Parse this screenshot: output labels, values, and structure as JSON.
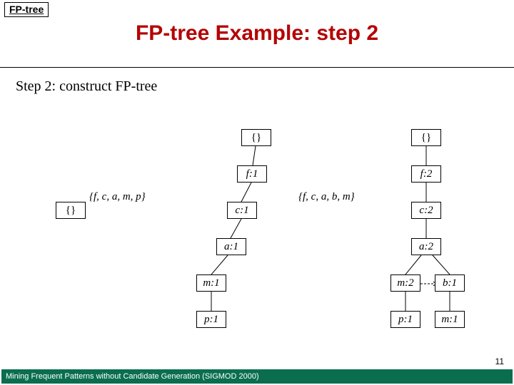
{
  "topic": "FP-tree",
  "title": "FP-tree Example: step 2",
  "step_label": "Step 2: construct  FP-tree",
  "footer": "Mining Frequent Patterns without Candidate Generation (SIGMOD 2000)",
  "page_number": "11",
  "empty": "{}",
  "tx1": "{f, c, a, m, p}",
  "tx2": "{f, c, a, b, m}",
  "nodes": {
    "t1_root": "{}",
    "t1_f1": "f:1",
    "t1_c1": "c:1",
    "t1_a1": "a:1",
    "t1_m1": "m:1",
    "t1_p1": "p:1",
    "t2_root": "{}",
    "t2_f2": "f:2",
    "t2_c2": "c:2",
    "t2_a2": "a:2",
    "t2_m2": "m:2",
    "t2_p1": "p:1",
    "t2_b1": "b:1",
    "t2_m1b": "m:1"
  }
}
